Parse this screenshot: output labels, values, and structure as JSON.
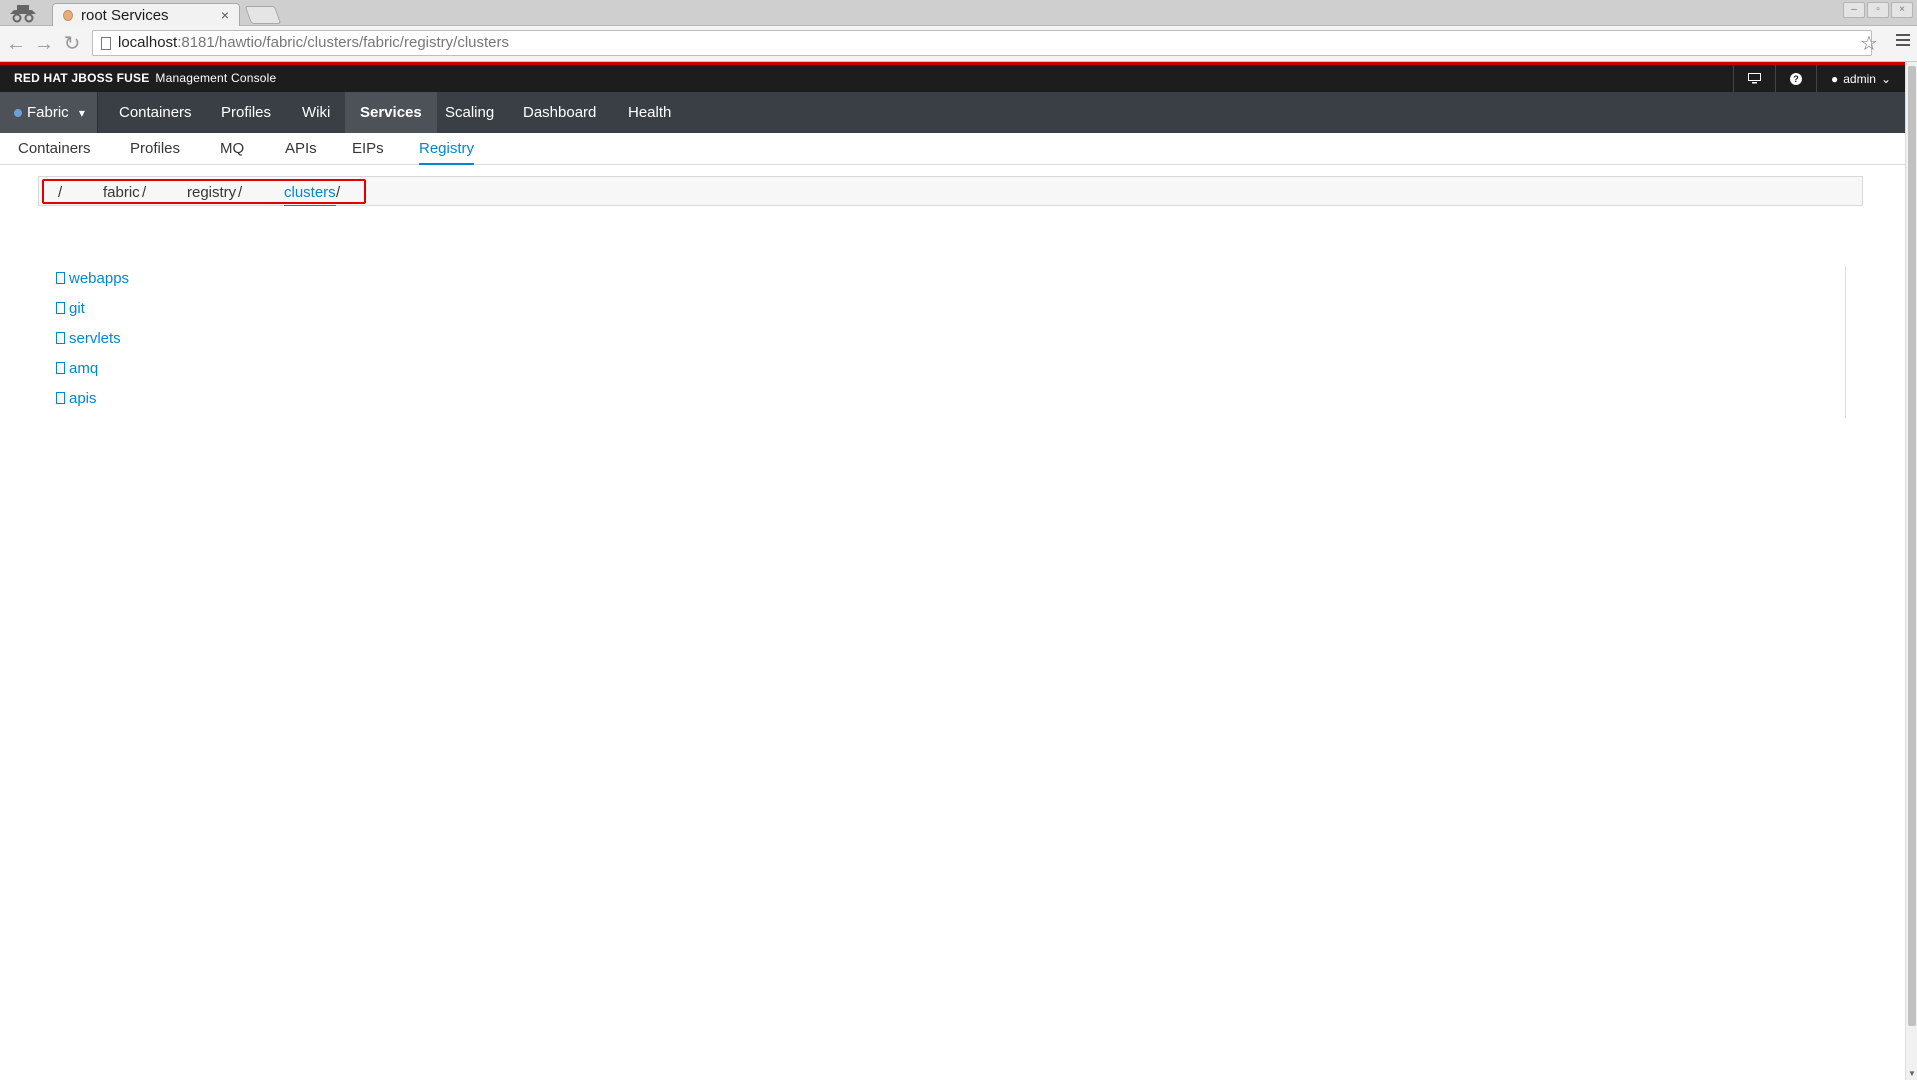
{
  "browser": {
    "tab_title": "root Services",
    "tab_close": "×",
    "url_host": "localhost",
    "url_rest": ":8181/hawtio/fabric/clusters/fabric/registry/clusters"
  },
  "header": {
    "brand": "RED HAT JBOSS FUSE",
    "brand_sub": "Management Console",
    "user": "admin",
    "help": "?"
  },
  "main_nav": {
    "fabric": "Fabric",
    "items": [
      "Containers",
      "Profiles",
      "Wiki",
      "Services",
      "Scaling",
      "Dashboard",
      "Health"
    ],
    "active": "Services"
  },
  "sub_nav": {
    "items": [
      "Containers",
      "Profiles",
      "MQ",
      "APIs",
      "EIPs",
      "Registry"
    ],
    "active": "Registry"
  },
  "breadcrumb": {
    "root": "/",
    "fabric": "fabric",
    "registry": "registry",
    "clusters": "clusters",
    "sep": "/"
  },
  "entries": [
    "webapps",
    "git",
    "servlets",
    "amq",
    "apis"
  ],
  "colors": {
    "accent": "#0088ce",
    "nav_bg": "#393f44",
    "brand_bg": "#1d1d1d",
    "highlight": "#e00000"
  }
}
